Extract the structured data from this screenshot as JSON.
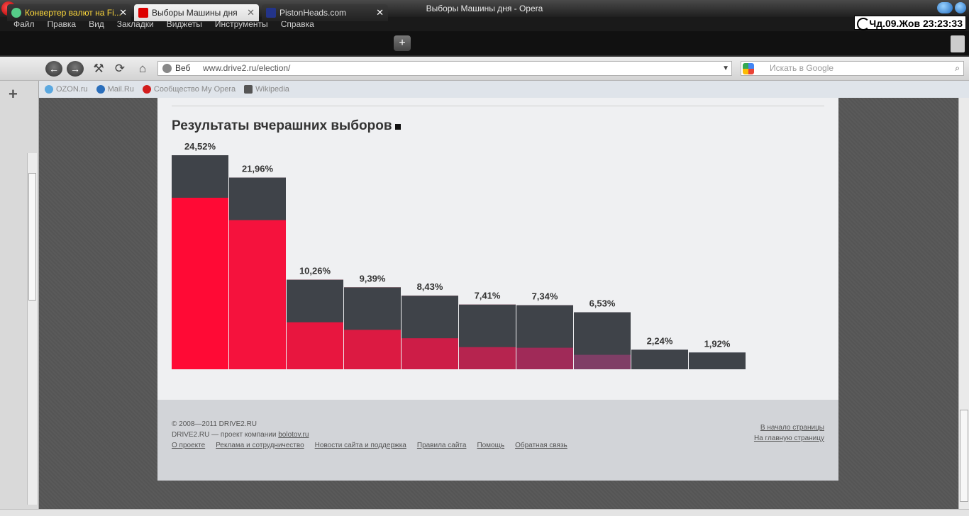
{
  "window": {
    "title": "Выборы Машины дня - Opera",
    "clock": "Чд.09.Жов 23:23:33"
  },
  "menu": [
    "Файл",
    "Правка",
    "Вид",
    "Закладки",
    "Виджеты",
    "Инструменты",
    "Справка"
  ],
  "tabs": [
    {
      "label": "Конвертер валют на Fi..."
    },
    {
      "label": "Выборы Машины дня"
    },
    {
      "label": "PistonHeads.com"
    }
  ],
  "address": {
    "scope": "Веб",
    "url": "www.drive2.ru/election/",
    "search_placeholder": "Искать в Google"
  },
  "bookmarks": [
    "OZON.ru",
    "Mail.Ru",
    "Сообщество My Opera",
    "Wikipedia"
  ],
  "page": {
    "heading": "Результаты вчерашних выборов"
  },
  "chart_data": {
    "type": "bar",
    "title": "Результаты вчерашних выборов",
    "unit": "%",
    "labels": [
      "24,52%",
      "21,96%",
      "10,26%",
      "9,39%",
      "8,43%",
      "7,41%",
      "7,34%",
      "6,53%",
      "2,24%",
      "1,92%"
    ],
    "values": [
      24.52,
      21.96,
      10.26,
      9.39,
      8.43,
      7.41,
      7.34,
      6.53,
      2.24,
      1.92
    ],
    "colors": [
      "#ff0a35",
      "#f5123d",
      "#e8163f",
      "#dc1a42",
      "#cd1d47",
      "#b6244f",
      "#a02a58",
      "#7f3e66",
      "#5d4d72",
      "#4c5276"
    ]
  },
  "footer": {
    "copyright": "© 2008—2011 DRIVE2.RU",
    "company_text": "DRIVE2.RU — проект компании ",
    "company_link": "bolotov.ru",
    "links": [
      "О проекте",
      "Реклама и сотрудничество",
      "Новости сайта и поддержка",
      "Правила сайта",
      "Помощь",
      "Обратная связь"
    ],
    "top_link": "В начало страницы",
    "home_link": "На главную страницу"
  }
}
